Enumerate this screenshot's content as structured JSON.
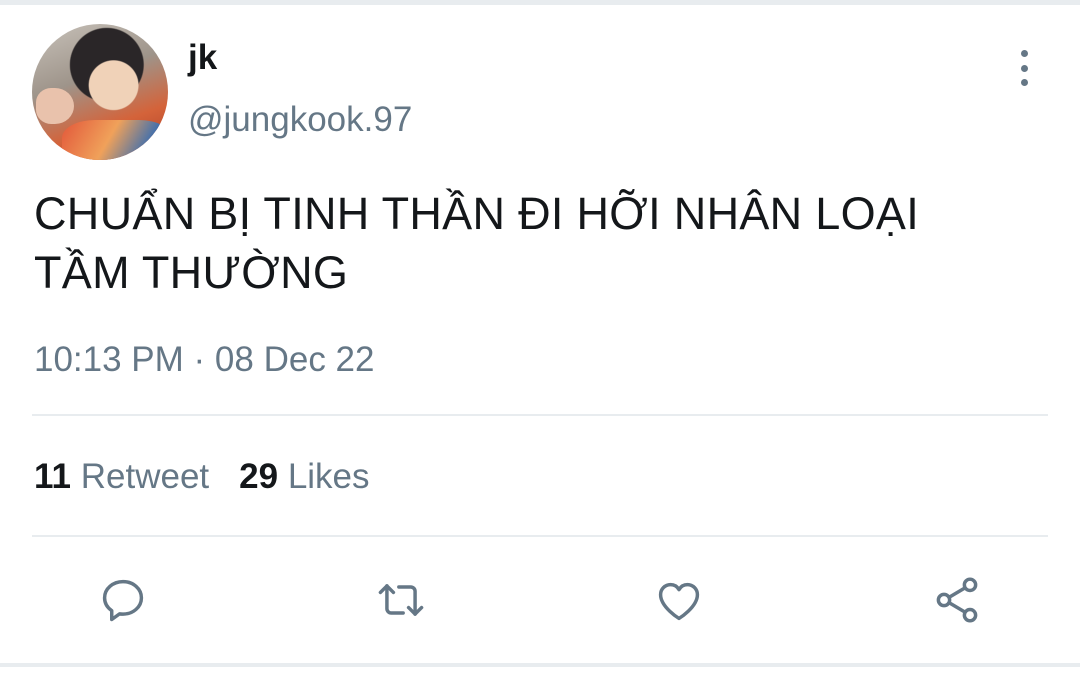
{
  "tweet": {
    "author_name": "jk",
    "author_handle": "@jungkook.97",
    "text_line1": "CHUẨN BỊ TINH THẦN ĐI HỠI NHÂN LOẠI",
    "text_line2": "TẦM THƯỜNG",
    "time": "10:13 PM",
    "separator": " · ",
    "date": "08 Dec 22"
  },
  "stats": {
    "retweets_count": "11",
    "retweets_label": "Retweet",
    "likes_count": "29",
    "likes_label": "Likes"
  },
  "icons": {
    "more": "more-vertical-icon",
    "reply": "reply-icon",
    "retweet": "retweet-icon",
    "like": "heart-icon",
    "share": "share-icon"
  },
  "colors": {
    "text": "#14171a",
    "secondary": "#657786",
    "divider": "#e8ecef"
  }
}
